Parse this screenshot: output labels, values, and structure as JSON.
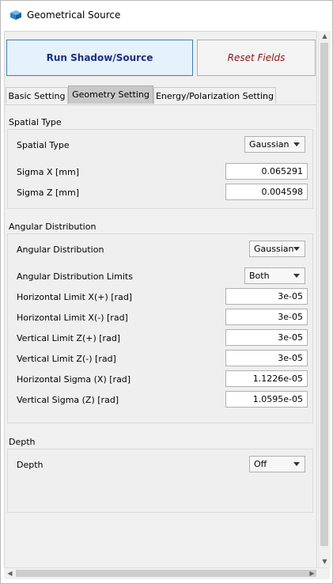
{
  "window": {
    "title": "Geometrical Source"
  },
  "buttons": {
    "run": "Run Shadow/Source",
    "reset": "Reset Fields"
  },
  "tabs": [
    {
      "label": "Basic Setting"
    },
    {
      "label": "Geometry Setting"
    },
    {
      "label": "Energy/Polarization Setting"
    }
  ],
  "spatial": {
    "section_title": "Spatial Type",
    "type_label": "Spatial Type",
    "type_value": "Gaussian",
    "sigma_x_label": "Sigma X [mm]",
    "sigma_x_value": "0.065291",
    "sigma_z_label": "Sigma Z [mm]",
    "sigma_z_value": "0.004598"
  },
  "angular": {
    "section_title": "Angular Distribution",
    "dist_label": "Angular Distribution",
    "dist_value": "Gaussian",
    "limits_label": "Angular Distribution Limits",
    "limits_value": "Both",
    "h_plus_label": "Horizontal Limit X(+) [rad]",
    "h_plus_value": "3e-05",
    "h_minus_label": "Horizontal Limit X(-) [rad]",
    "h_minus_value": "3e-05",
    "v_plus_label": "Vertical Limit Z(+) [rad]",
    "v_plus_value": "3e-05",
    "v_minus_label": "Vertical Limit Z(-) [rad]",
    "v_minus_value": "3e-05",
    "h_sigma_label": "Horizontal Sigma (X) [rad]",
    "h_sigma_value": "1.1226e-05",
    "v_sigma_label": "Vertical Sigma (Z) [rad]",
    "v_sigma_value": "1.0595e-05"
  },
  "depth": {
    "section_title": "Depth",
    "depth_label": "Depth",
    "depth_value": "Off"
  },
  "icons": {
    "app": "app-cube-icon",
    "scroll_up": "up-arrow-icon",
    "scroll_down": "down-arrow-icon",
    "scroll_left": "left-arrow-icon",
    "scroll_right": "right-arrow-icon"
  }
}
